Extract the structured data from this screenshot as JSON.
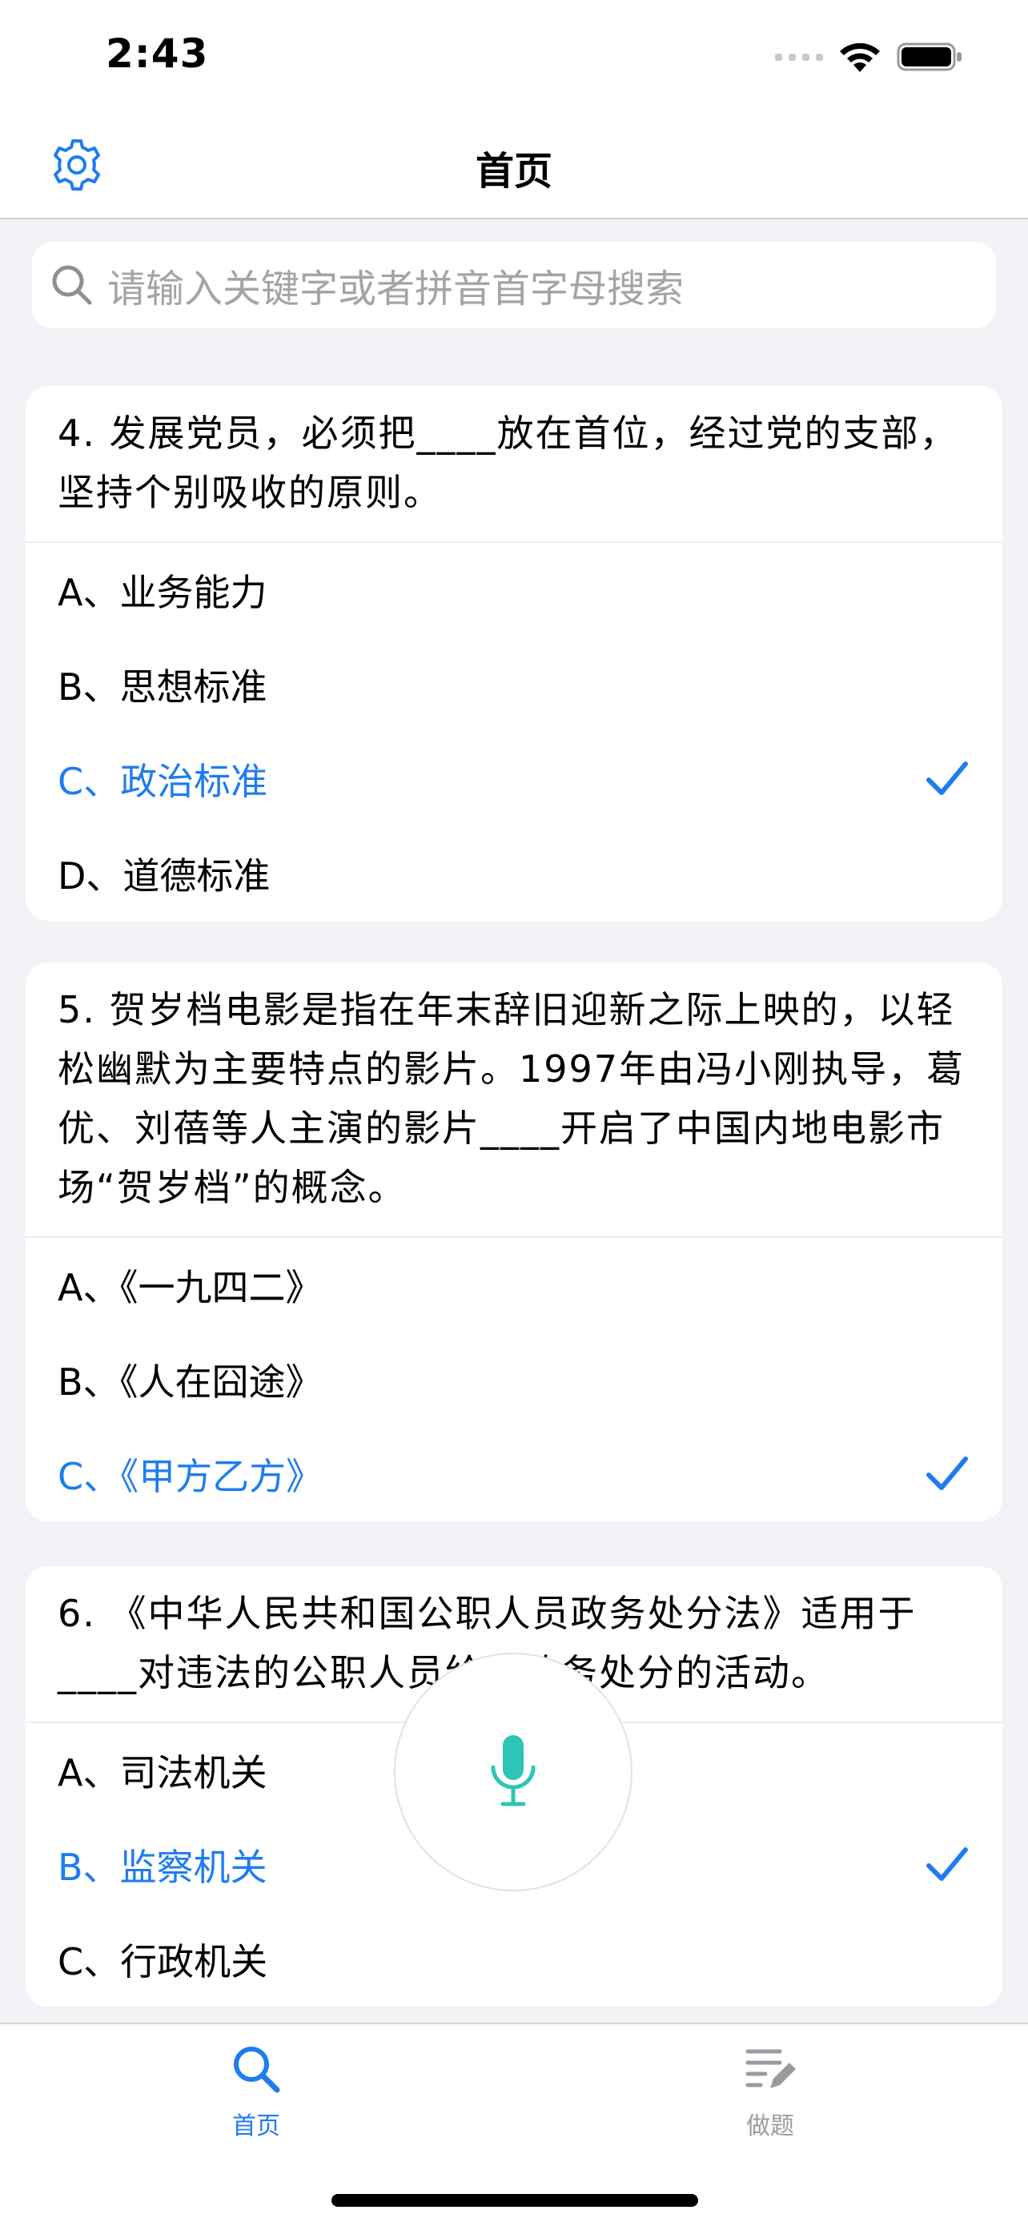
{
  "status": {
    "time": "2:43"
  },
  "nav": {
    "title": "首页",
    "settings_icon": "gear-icon"
  },
  "search": {
    "placeholder": "请输入关键字或者拼音首字母搜索",
    "icon": "search-icon"
  },
  "questions": [
    {
      "text": "4. 发展党员，必须把____放在首位，经过党的支部，坚持个别吸收的原则。",
      "options": [
        {
          "label": "A、业务能力",
          "correct": false
        },
        {
          "label": "B、思想标准",
          "correct": false
        },
        {
          "label": "C、政治标准",
          "correct": true
        },
        {
          "label": "D、道德标准",
          "correct": false
        }
      ]
    },
    {
      "text": "5. 贺岁档电影是指在年末辞旧迎新之际上映的，以轻松幽默为主要特点的影片。1997年由冯小刚执导，葛优、刘蓓等人主演的影片____开启了中国内地电影市场“贺岁档”的概念。",
      "options": [
        {
          "label": "A、《一九四二》",
          "correct": false
        },
        {
          "label": "B、《人在囧途》",
          "correct": false
        },
        {
          "label": "C、《甲方乙方》",
          "correct": true
        }
      ]
    },
    {
      "text": "6. 《中华人民共和国公职人员政务处分法》适用于____对违法的公职人员给予政务处分的活动。",
      "options": [
        {
          "label": "A、司法机关",
          "correct": false
        },
        {
          "label": "B、监察机关",
          "correct": true
        },
        {
          "label": "C、行政机关",
          "correct": false
        }
      ]
    }
  ],
  "tabs": [
    {
      "label": "首页",
      "icon": "search-icon",
      "active": true
    },
    {
      "label": "做题",
      "icon": "edit-list-icon",
      "active": false
    }
  ],
  "colors": {
    "accent": "#1e7cf0",
    "mic": "#2ec4b6",
    "background": "#f2f2f7"
  }
}
